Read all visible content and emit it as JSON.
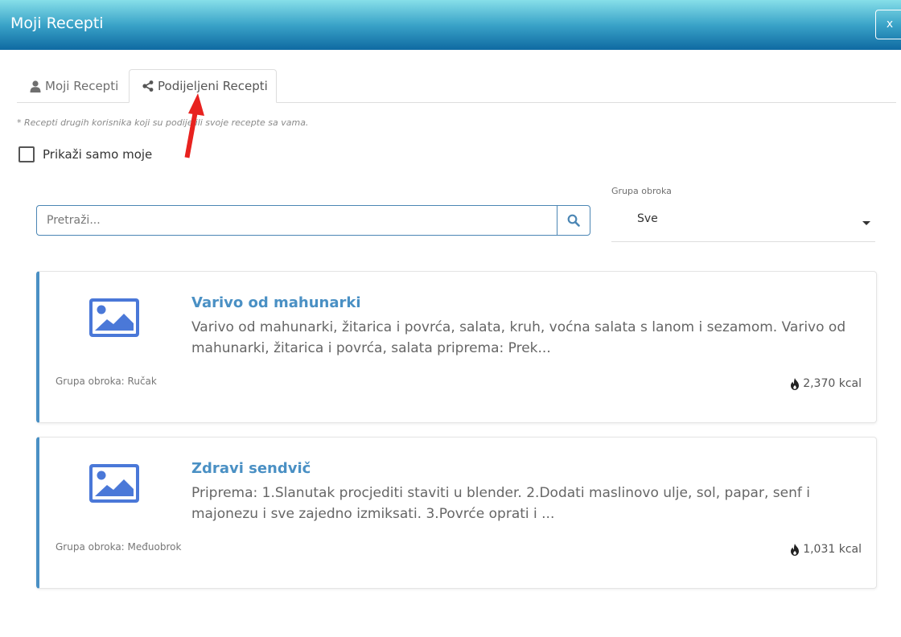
{
  "header": {
    "title": "Moji Recepti",
    "close_label": "x"
  },
  "tabs": [
    {
      "label": "Moji Recepti",
      "icon": "user-icon",
      "active": false
    },
    {
      "label": "Podijeljeni Recepti",
      "icon": "share-icon",
      "active": true
    }
  ],
  "note": "* Recepti drugih korisnika koji su podijelili svoje recepte sa vama.",
  "filter": {
    "only_mine_label": "Prikaži samo moje",
    "only_mine_checked": false
  },
  "search": {
    "placeholder": "Pretraži...",
    "value": ""
  },
  "meal_group": {
    "label": "Grupa obroka",
    "selected": "Sve"
  },
  "recipes": [
    {
      "title": "Varivo od mahunarki",
      "description": "Varivo od mahunarki, žitarica i povrća, salata, kruh, voćna salata s lanom i sezamom. Varivo od mahunarki, žitarica i povrća, salata priprema: Prek...",
      "group": "Grupa obroka: Ručak",
      "kcal": "2,370 kcal"
    },
    {
      "title": "Zdravi sendvič",
      "description": "Priprema: 1.Slanutak procjediti staviti u blender. 2.Dodati maslinovo ulje, sol, papar, senf i majonezu i sve zajedno izmiksati. 3.Povrće oprati i ...",
      "group": "Grupa obroka: Međuobrok",
      "kcal": "1,031 kcal"
    }
  ],
  "colors": {
    "accent": "#4a90c4",
    "image_placeholder": "#4a78d8",
    "arrow": "#e8221f",
    "header_top": "#86dfe9",
    "header_bottom": "#0f6aa2"
  }
}
